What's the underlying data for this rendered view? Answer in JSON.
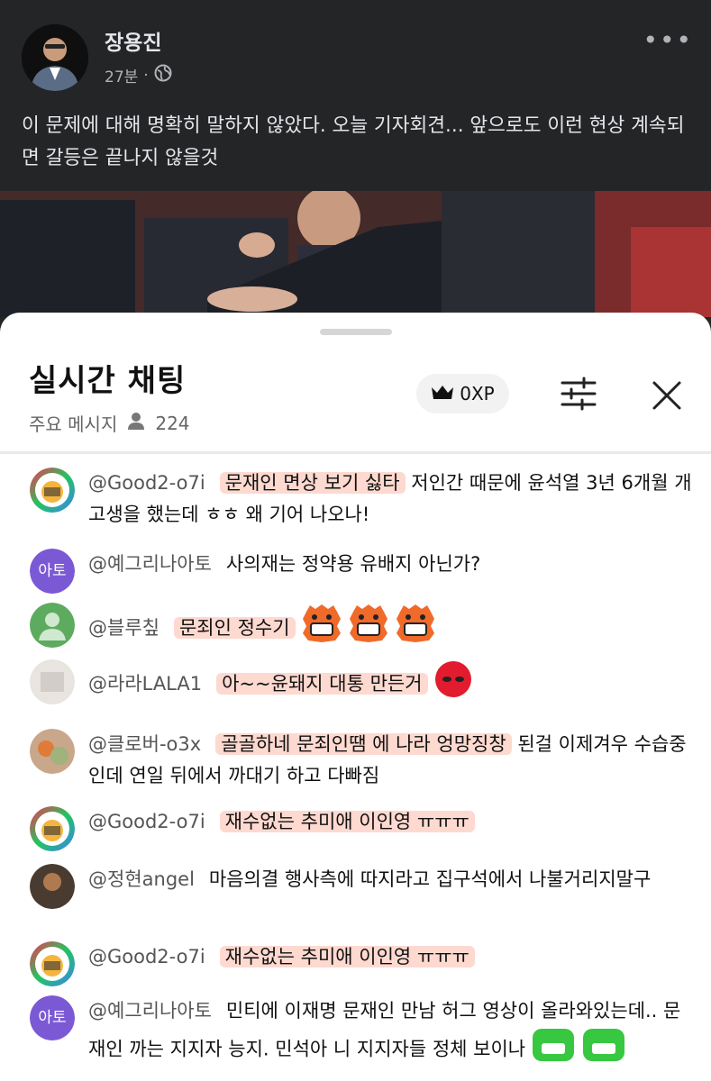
{
  "post": {
    "author": "장용진",
    "time": "27분",
    "text": "이 문제에 대해 명확히 말하지 않았다. 오늘 기자회견... 앞으로도 이런 현상 계속되면 갈등은 끝나지 않을것"
  },
  "chat": {
    "title": "실시간 채팅",
    "xp": "0XP",
    "tab": "주요 메시지",
    "viewers": "224",
    "messages": [
      {
        "name": "@Good2-o7i",
        "highlight": "문재인 면상 보기 싫타",
        "rest": " 저인간 때문에 윤석열 3년 6개월 개고생을 했는데 ㅎㅎ 왜 기어 나오나!",
        "avatar": "qr-face"
      },
      {
        "name": "@예그리나아토",
        "highlight": "",
        "rest": "사의재는 정약용 유배지 아닌가?",
        "avatar": "text",
        "avatar_text": "아토"
      },
      {
        "name": "@블루칲",
        "highlight": "문죄인 정수기",
        "rest": "",
        "avatar": "person",
        "emoji": "angry-face-icon"
      },
      {
        "name": "@라라LALA1",
        "highlight": "아~~윤돼지 대통 만든거",
        "rest": "",
        "avatar": "photo-white",
        "emoji": "red-blob-icon"
      },
      {
        "name": "@클로버-o3x",
        "highlight": "골골하네 문죄인땜 에 나라 엉망징창",
        "rest": " 된걸 이제겨우 수습중인데 연일 뒤에서 까대기 하고 다빠짐",
        "avatar": "photo-orange"
      },
      {
        "name": "@Good2-o7i",
        "highlight": "재수없는 추미애 이인영 ㅠㅠㅠ",
        "rest": "",
        "avatar": "qr-face"
      },
      {
        "name": "@정현angel",
        "highlight": "",
        "rest": "마음의결 행사측에 따지라고 집구석에서 나불거리지말구",
        "avatar": "photo-dark"
      },
      {
        "name": "@Good2-o7i",
        "highlight": "재수없는 추미애 이인영 ㅠㅠㅠ",
        "rest": "",
        "avatar": "qr-face"
      },
      {
        "name": "@예그리나아토",
        "highlight": "",
        "rest": "민티에 이재명 문재인 만남 허그 영상이 올라와있는데.. 문재인 까는 지지자 능지. 민석아 니 지지자들 정체 보이나",
        "avatar": "text",
        "avatar_text": "아토",
        "emoji": "green-face-icon"
      }
    ]
  },
  "colors": {
    "bg_dark": "#242526",
    "highlight": "#f9b5a3",
    "avatar_purple": "#7b59d4"
  }
}
